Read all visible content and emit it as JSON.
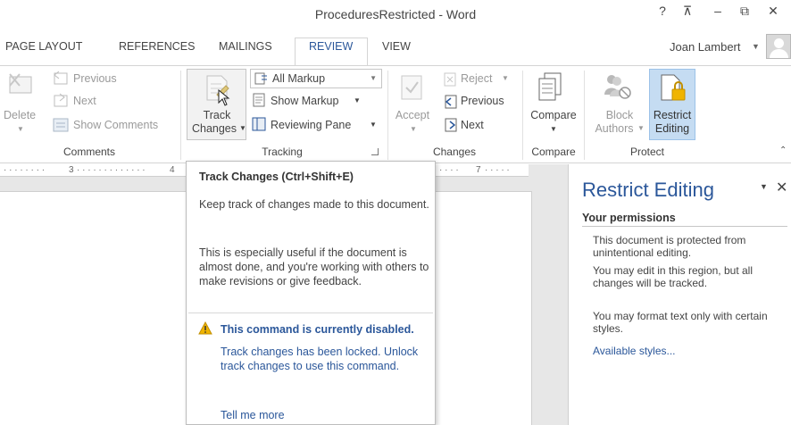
{
  "window": {
    "title": "ProceduresRestricted - Word",
    "help": "?",
    "ribbon_display": "⊼",
    "minimize": "–",
    "restore": "⧉",
    "close": "✕"
  },
  "tabs": [
    {
      "label": "PAGE LAYOUT",
      "active": false
    },
    {
      "label": "REFERENCES",
      "active": false
    },
    {
      "label": "MAILINGS",
      "active": false
    },
    {
      "label": "REVIEW",
      "active": true
    },
    {
      "label": "VIEW",
      "active": false
    }
  ],
  "user": {
    "name": "Joan Lambert"
  },
  "ribbon": {
    "comments": {
      "label": "Comments",
      "delete": "Delete",
      "previous": "Previous",
      "next": "Next",
      "show_comments": "Show Comments"
    },
    "tracking": {
      "label": "Tracking",
      "track_line1": "Track",
      "track_line2": "Changes",
      "markup_value": "All Markup",
      "show_markup": "Show Markup",
      "reviewing_pane": "Reviewing Pane"
    },
    "changes": {
      "label": "Changes",
      "accept": "Accept",
      "reject": "Reject",
      "previous": "Previous",
      "next": "Next"
    },
    "compare": {
      "label": "Compare",
      "compare": "Compare"
    },
    "protect": {
      "label": "Protect",
      "block_line1": "Block",
      "block_line2": "Authors",
      "restrict_line1": "Restrict",
      "restrict_line2": "Editing"
    }
  },
  "ruler": {
    "marks": [
      "3",
      "4",
      "7"
    ]
  },
  "tooltip": {
    "title": "Track Changes (Ctrl+Shift+E)",
    "desc1": "Keep track of changes made to this document.",
    "desc2": "This is especially useful if the document is almost done, and you're working with others to make revisions or give feedback.",
    "warning": "This command is currently disabled.",
    "locked": "Track changes has been locked. Unlock track changes to use this command.",
    "tell_more": "Tell me more"
  },
  "pane": {
    "title": "Restrict Editing",
    "section": "Your permissions",
    "p1": "This document is protected from unintentional editing.",
    "p2": "You may edit in this region, but all changes will be tracked.",
    "p3": "You may format text only with certain styles.",
    "link": "Available styles..."
  },
  "colors": {
    "accent": "#2b579a",
    "highlight": "#c5dcf2",
    "warning": "#f0b400"
  }
}
